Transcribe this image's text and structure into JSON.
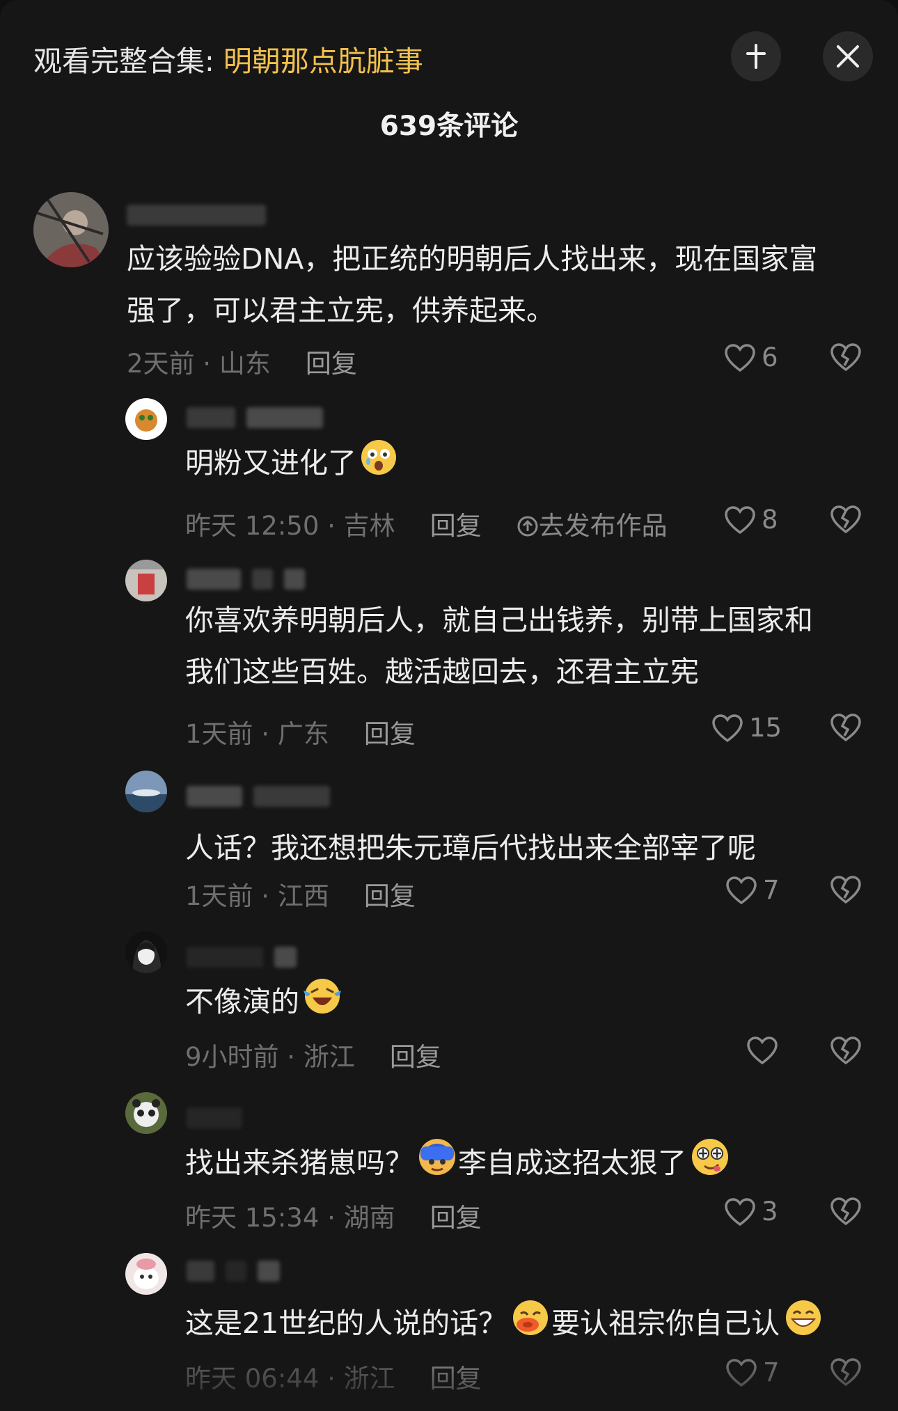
{
  "header": {
    "collection_prefix": "观看完整合集: ",
    "collection_title": "明朝那点肮脏事",
    "comment_count": "639条评论",
    "icons": [
      "collapse-icon",
      "close-icon"
    ]
  },
  "colors": {
    "accent": "#f2c14e",
    "background": "#161616"
  },
  "comments": [
    {
      "text_lines": [
        "应该验验DNA，把正统的明朝后人找出来，现在国家富",
        "强了，可以君主立宪，供养起来。"
      ],
      "time_location": "2天前 · 山东",
      "reply_label": "回复",
      "likes": "6"
    },
    {
      "text_lines": [
        "明粉又进化了"
      ],
      "emoji": [
        "astonished-emoji"
      ],
      "time_location": "昨天 12:50 · 吉林",
      "reply_label": "回复",
      "publish_label": "去发布作品",
      "likes": "8"
    },
    {
      "text_lines": [
        "你喜欢养明朝后人，就自己出钱养，别带上国家和",
        "我们这些百姓。越活越回去，还君主立宪"
      ],
      "time_location": "1天前 · 广东",
      "reply_label": "回复",
      "likes": "15"
    },
    {
      "text_lines": [
        "人话？我还想把朱元璋后代找出来全部宰了呢"
      ],
      "time_location": "1天前 · 江西",
      "reply_label": "回复",
      "likes": "7"
    },
    {
      "text_lines": [
        "不像演的"
      ],
      "emoji": [
        "laughing-crying-emoji"
      ],
      "time_location": "9小时前 · 浙江",
      "reply_label": "回复",
      "likes": ""
    },
    {
      "text_parts": [
        "找出来杀猪崽吗？",
        "李自成这招太狠了"
      ],
      "emoji": [
        "blue-face-emoji",
        "dizzy-face-emoji"
      ],
      "time_location": "昨天 15:34 · 湖南",
      "reply_label": "回复",
      "likes": "3"
    },
    {
      "text_parts": [
        "这是21世纪的人说的话？",
        "要认祖宗你自己认"
      ],
      "emoji": [
        "pouting-emoji",
        "grinning-emoji"
      ],
      "time_location": "昨天 06:44 · 浙江",
      "reply_label": "回复",
      "likes": "7"
    }
  ]
}
